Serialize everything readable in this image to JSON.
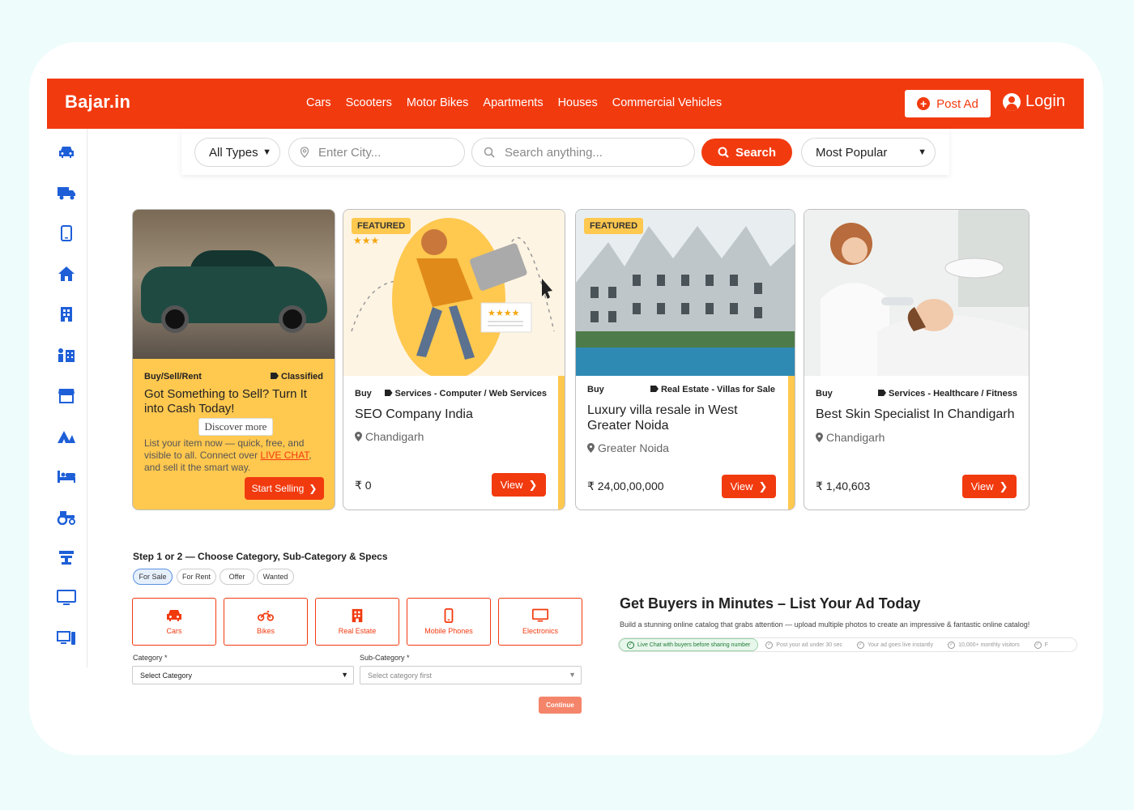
{
  "header": {
    "logo": "Bajar.in",
    "nav": [
      "Cars",
      "Scooters",
      "Motor Bikes",
      "Apartments",
      "Houses",
      "Commercial Vehicles"
    ],
    "post_ad": "Post Ad",
    "login": "Login"
  },
  "sidebar": {
    "icons": [
      "car-icon",
      "truck-icon",
      "mobile-icon",
      "home-icon",
      "building-icon",
      "people-building-icon",
      "store-icon",
      "camping-icon",
      "bed-icon",
      "tractor-icon",
      "industry-icon",
      "monitor-icon",
      "devices-icon"
    ]
  },
  "search": {
    "type_selected": "All Types",
    "city_placeholder": "Enter City...",
    "query_placeholder": "Search anything...",
    "button": "Search",
    "sort_selected": "Most Popular"
  },
  "promo_card": {
    "left_tag": "Buy/Sell/Rent",
    "right_tag": "Classified",
    "headline": "Got Something to Sell? Turn It into Cash Today!",
    "discover": "Discover more",
    "desc_before": "List your item now — quick, free, and visible to all. Connect over ",
    "desc_link": "LIVE CHAT",
    "desc_after": ", and sell it the smart way.",
    "button": "Start Selling"
  },
  "listings": [
    {
      "featured": "FEATURED",
      "type": "Buy",
      "category": "Services - Computer / Web Services",
      "title": "SEO Company India",
      "location": "Chandigarh",
      "price": "₹ 0",
      "button": "View"
    },
    {
      "featured": "FEATURED",
      "type": "Buy",
      "category": "Real Estate - Villas for Sale",
      "title": "Luxury villa resale in West Greater Noida",
      "location": "Greater Noida",
      "price": "₹ 24,00,00,000",
      "button": "View"
    },
    {
      "featured": "",
      "type": "Buy",
      "category": "Services - Healthcare / Fitness",
      "title": "Best Skin Specialist In Chandigarh",
      "location": "Chandigarh",
      "price": "₹ 1,40,603",
      "button": "View"
    }
  ],
  "step": {
    "title": "Step 1 or 2 — Choose Category, Sub-Category & Specs",
    "pills": [
      "For Sale",
      "For Rent",
      "Offer",
      "Wanted"
    ],
    "categories": [
      "Cars",
      "Bikes",
      "Real Estate",
      "Mobile Phones",
      "Electronics"
    ],
    "category_label": "Category *",
    "category_value": "Select Category",
    "subcategory_label": "Sub-Category *",
    "subcategory_value": "Select category first",
    "continue": "Continue"
  },
  "promo2": {
    "title": "Get Buyers in Minutes – List Your Ad Today",
    "desc": "Build a stunning online catalog that grabs attention — upload multiple photos to create an impressive & fantastic online catalog!",
    "features": [
      "Live Chat with buyers before sharing number",
      "Post your ad under 30 sec",
      "Your ad goes live instantly",
      "10,000+ monthly visitors",
      "F"
    ]
  },
  "colors": {
    "brand": "#f23a0f",
    "accent_yellow": "#ffc84f",
    "icon_blue": "#1e5fd8"
  }
}
